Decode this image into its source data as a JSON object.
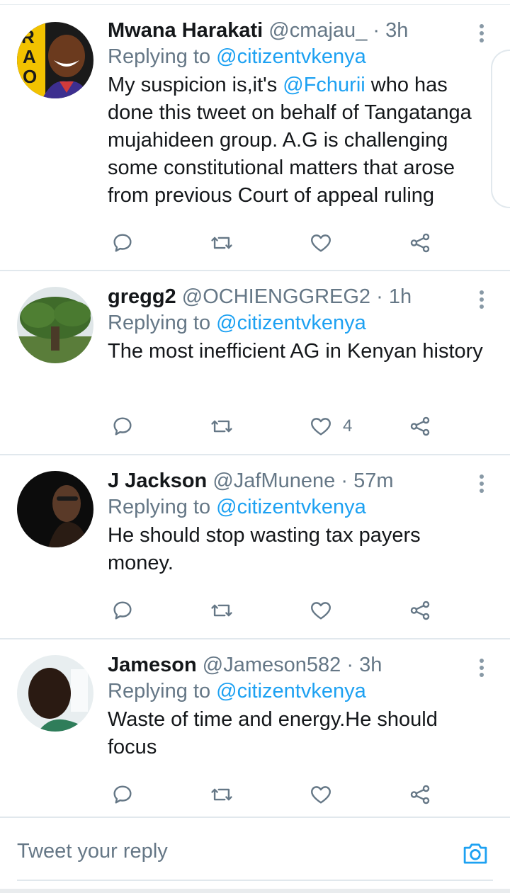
{
  "tweets": [
    {
      "name": "Mwana Harakati",
      "handle": "@cmajau_",
      "time": "3h",
      "replying_prefix": "Replying to ",
      "replying_to": "@citizentvkenya",
      "body_parts": [
        "My suspicion is,it's ",
        "@Fchurii",
        " who has done this tweet on behalf of Tangatanga mujahideen group. A.G is challenging some constitutional matters that arose from previous Court of appeal ruling"
      ],
      "likes": ""
    },
    {
      "name": "gregg2",
      "handle": "@OCHIENGGREG2",
      "time": "1h",
      "replying_prefix": "Replying to ",
      "replying_to": "@citizentvkenya",
      "body": "The most inefficient AG in Kenyan history",
      "likes": "4"
    },
    {
      "name": "J Jackson",
      "handle": "@JafMunene",
      "time": "57m",
      "replying_prefix": "Replying to ",
      "replying_to": "@citizentvkenya",
      "body": "He should stop wasting tax payers money.",
      "likes": ""
    },
    {
      "name": "Jameson",
      "handle": "@Jameson582",
      "time": "3h",
      "replying_prefix": "Replying to ",
      "replying_to": "@citizentvkenya",
      "body": "Waste of time and energy.He should focus",
      "likes": ""
    }
  ],
  "separator": "·",
  "reply_bar": {
    "placeholder": "Tweet your reply"
  },
  "icons": [
    "reply-icon",
    "retweet-icon",
    "like-icon",
    "share-icon",
    "more-icon",
    "camera-icon"
  ],
  "colors": {
    "accent": "#1da1f2",
    "secondary": "#657786",
    "text": "#14171a"
  }
}
